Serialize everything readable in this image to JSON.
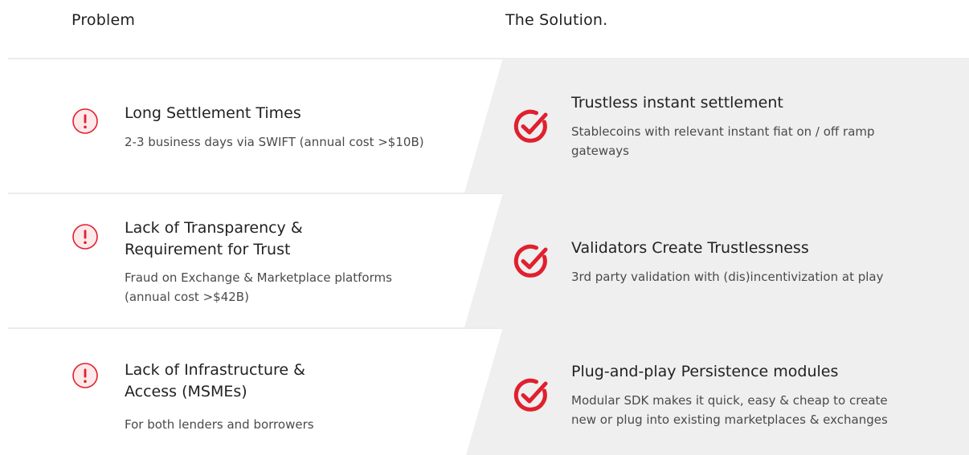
{
  "headings": {
    "problem": "Problem",
    "solution": "The Solution."
  },
  "colors": {
    "accent_red": "#e0202e",
    "icon_bg_pink": "#fde8ea",
    "solution_panel": "#efefef",
    "divider": "#ececec"
  },
  "rows": [
    {
      "problem": {
        "icon": "exclamation-icon",
        "title_lines": [
          "Long Settlement Times"
        ],
        "desc_lines": [
          "2-3 business days via SWIFT (annual cost >$10B)"
        ]
      },
      "solution": {
        "icon": "check-circle-icon",
        "title": "Trustless instant settlement",
        "desc_lines": [
          "Stablecoins with relevant instant fiat on / off ramp",
          "gateways"
        ]
      }
    },
    {
      "problem": {
        "icon": "exclamation-icon",
        "title_lines": [
          "Lack of Transparency &",
          "Requirement for Trust"
        ],
        "desc_lines": [
          "Fraud on Exchange & Marketplace platforms",
          "(annual cost >$42B)"
        ]
      },
      "solution": {
        "icon": "check-circle-icon",
        "title": "Validators Create Trustlessness",
        "desc_lines": [
          "3rd party validation with (dis)incentivization at play"
        ]
      }
    },
    {
      "problem": {
        "icon": "exclamation-icon",
        "title_lines": [
          "Lack of Infrastructure &",
          "Access (MSMEs)"
        ],
        "desc_lines": [
          "For both lenders and borrowers"
        ]
      },
      "solution": {
        "icon": "check-circle-icon",
        "title": "Plug-and-play Persistence modules",
        "desc_lines": [
          "Modular SDK makes it quick, easy & cheap to create",
          "new or plug into existing marketplaces & exchanges"
        ]
      }
    }
  ]
}
